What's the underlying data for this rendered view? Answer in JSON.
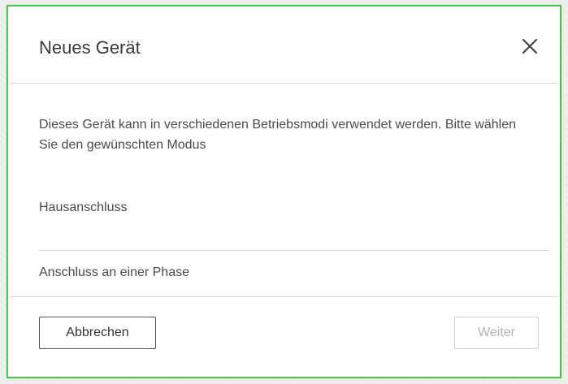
{
  "dialog": {
    "title": "Neues Gerät",
    "close_icon": "close-icon",
    "description": "Dieses Gerät kann in verschiedenen Betriebsmodi verwendet werden. Bitte wählen Sie den gewünschten Modus",
    "options": [
      {
        "label": "Hausanschluss"
      },
      {
        "label": "Anschluss an einer Phase"
      }
    ],
    "cancel_label": "Abbrechen",
    "next_label": "Weiter",
    "next_disabled": true
  },
  "colors": {
    "highlight_border": "#4cc04a",
    "text": "#4a4a4a",
    "divider": "#d9d9d9",
    "disabled_text": "#b2b2b2"
  }
}
